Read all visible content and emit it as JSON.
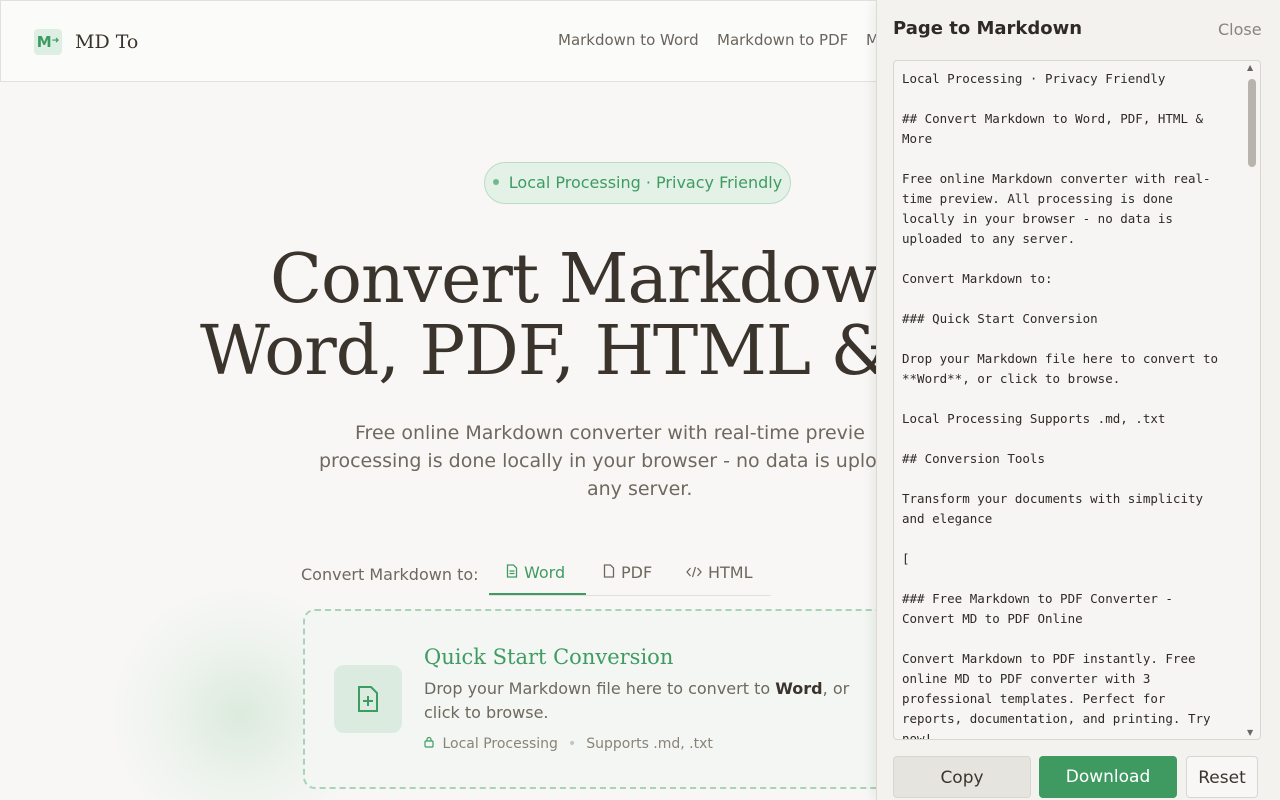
{
  "header": {
    "logo_mark": "M",
    "logo_arrow": "➜",
    "logo_text": "MD To",
    "nav": [
      "Markdown to Word",
      "Markdown to PDF",
      "M"
    ]
  },
  "hero": {
    "badge": "Local Processing · Privacy Friendly",
    "title_line1": "Convert Markdow",
    "title_line2": "Word, PDF, HTML &",
    "subtitle_line1": "Free online Markdown converter with real-time previe",
    "subtitle_line2": "processing is done locally in your browser - no data is uplo",
    "subtitle_line3": "any server."
  },
  "converter": {
    "label": "Convert Markdown to:",
    "tabs": [
      {
        "label": "Word",
        "icon": "document-icon"
      },
      {
        "label": "PDF",
        "icon": "file-icon"
      },
      {
        "label": "HTML",
        "icon": "code-icon"
      }
    ],
    "active_tab": "Word",
    "dropzone": {
      "title": "Quick Start Conversion",
      "desc_before": "Drop your Markdown file here to convert to ",
      "desc_bold": "Word",
      "desc_after": ", or click to browse.",
      "meta_local": "Local Processing",
      "meta_supports": "Supports .md, .txt"
    }
  },
  "panel": {
    "title": "Page to Markdown",
    "close": "Close",
    "markdown": "Local Processing · Privacy Friendly\n\n## Convert Markdown to Word, PDF, HTML &\nMore\n\nFree online Markdown converter with real-\ntime preview. All processing is done\nlocally in your browser - no data is\nuploaded to any server.\n\nConvert Markdown to:\n\n### Quick Start Conversion\n\nDrop your Markdown file here to convert to\n**Word**, or click to browse.\n\nLocal Processing Supports .md, .txt\n\n## Conversion Tools\n\nTransform your documents with simplicity\nand elegance\n\n[\n\n### Free Markdown to PDF Converter -\nConvert MD to PDF Online\n\nConvert Markdown to PDF instantly. Free\nonline MD to PDF converter with 3\nprofessional templates. Perfect for\nreports, documentation, and printing. Try\nnow!",
    "buttons": {
      "copy": "Copy",
      "download": "Download",
      "reset": "Reset"
    },
    "accent": "#3f9a62"
  }
}
